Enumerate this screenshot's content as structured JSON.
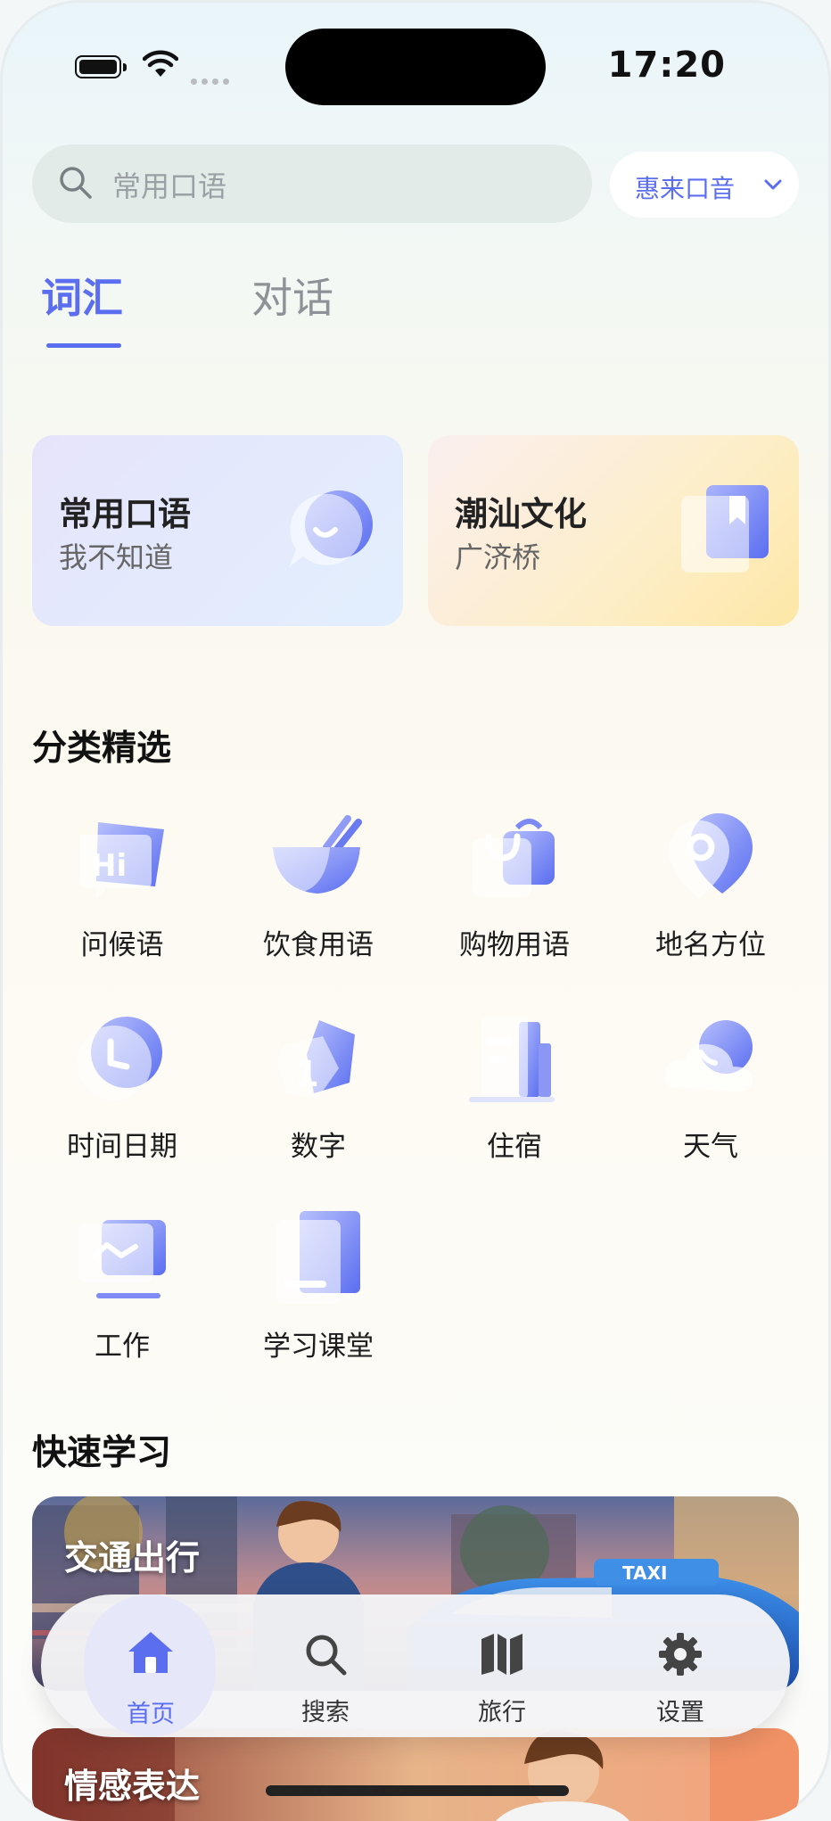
{
  "status_bar": {
    "time": "17:20"
  },
  "search": {
    "placeholder": "常用口语",
    "icon": "search-icon"
  },
  "dialect_selector": {
    "label": "惠来口音",
    "icon": "chevron-down-icon"
  },
  "tabs": [
    {
      "label": "词汇",
      "active": true
    },
    {
      "label": "对话",
      "active": false
    }
  ],
  "feature_cards": [
    {
      "title": "常用口语",
      "subtitle": "我不知道",
      "icon": "speech-bubble-icon"
    },
    {
      "title": "潮汕文化",
      "subtitle": "广济桥",
      "icon": "bookmark-book-icon"
    }
  ],
  "categories_section": {
    "title": "分类精选",
    "items": [
      {
        "label": "问候语",
        "icon": "hi-chat-icon"
      },
      {
        "label": "饮食用语",
        "icon": "bowl-chopsticks-icon"
      },
      {
        "label": "购物用语",
        "icon": "shopping-bag-icon"
      },
      {
        "label": "地名方位",
        "icon": "location-pin-icon"
      },
      {
        "label": "时间日期",
        "icon": "clock-icon"
      },
      {
        "label": "数字",
        "icon": "number-one-icon"
      },
      {
        "label": "住宿",
        "icon": "building-icon"
      },
      {
        "label": "天气",
        "icon": "cloud-moon-icon"
      },
      {
        "label": "工作",
        "icon": "monitor-chart-icon"
      },
      {
        "label": "学习课堂",
        "icon": "notebook-icon"
      }
    ]
  },
  "quick_section": {
    "title": "快速学习",
    "items": [
      {
        "title": "交通出行",
        "taxi_sign": "TAXI"
      },
      {
        "title": "情感表达"
      }
    ]
  },
  "tab_bar": {
    "items": [
      {
        "label": "首页",
        "icon": "home-icon",
        "active": true
      },
      {
        "label": "搜索",
        "icon": "search-icon",
        "active": false
      },
      {
        "label": "旅行",
        "icon": "map-icon",
        "active": false
      },
      {
        "label": "设置",
        "icon": "gear-icon",
        "active": false
      }
    ]
  },
  "colors": {
    "accent": "#5b6ef0",
    "text": "#1c1c1c",
    "muted": "#8e9297"
  }
}
